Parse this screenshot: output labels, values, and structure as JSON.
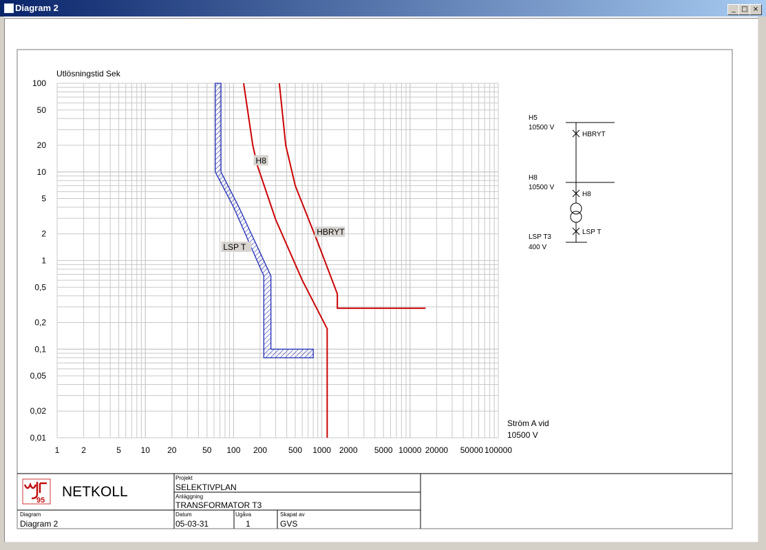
{
  "window": {
    "title": "Diagram 2",
    "min_glyph": "_",
    "max_glyph": "□",
    "close_glyph": "×"
  },
  "chart_data": {
    "type": "line",
    "xscale": "log",
    "yscale": "log",
    "xlim": [
      1,
      100000
    ],
    "ylim": [
      0.01,
      100
    ],
    "ylabel": "Utlösningstid Sek",
    "xlabel_lines": [
      "Ström A vid",
      "10500 V"
    ],
    "xticks": [
      {
        "v": 1,
        "t": "1"
      },
      {
        "v": 2,
        "t": "2"
      },
      {
        "v": 5,
        "t": "5"
      },
      {
        "v": 10,
        "t": "10"
      },
      {
        "v": 20,
        "t": "20"
      },
      {
        "v": 50,
        "t": "50"
      },
      {
        "v": 100,
        "t": "100"
      },
      {
        "v": 200,
        "t": "200"
      },
      {
        "v": 500,
        "t": "500"
      },
      {
        "v": 1000,
        "t": "1000"
      },
      {
        "v": 2000,
        "t": "2000"
      },
      {
        "v": 5000,
        "t": "5000"
      },
      {
        "v": 10000,
        "t": "10000"
      },
      {
        "v": 20000,
        "t": "20000"
      },
      {
        "v": 50000,
        "t": "50000"
      },
      {
        "v": 100000,
        "t": "100000"
      }
    ],
    "yticks": [
      {
        "v": 100,
        "t": "100"
      },
      {
        "v": 50,
        "t": "50"
      },
      {
        "v": 20,
        "t": "20"
      },
      {
        "v": 10,
        "t": "10"
      },
      {
        "v": 5,
        "t": "5"
      },
      {
        "v": 2,
        "t": "2"
      },
      {
        "v": 1,
        "t": "1"
      },
      {
        "v": 0.5,
        "t": "0,5"
      },
      {
        "v": 0.2,
        "t": "0,2"
      },
      {
        "v": 0.1,
        "t": "0,1"
      },
      {
        "v": 0.05,
        "t": "0,05"
      },
      {
        "v": 0.02,
        "t": "0,02"
      },
      {
        "v": 0.01,
        "t": "0,01"
      }
    ],
    "grid": true,
    "series": [
      {
        "name": "HBRYT",
        "color": "#cc0000",
        "points": [
          [
            330,
            100
          ],
          [
            390,
            20
          ],
          [
            500,
            7
          ],
          [
            900,
            1.6
          ],
          [
            1500,
            0.42
          ],
          [
            1500,
            0.29
          ],
          [
            15000,
            0.29
          ]
        ],
        "label_at": [
          860,
          1.95
        ]
      },
      {
        "name": "H8",
        "color": "#cc0000",
        "points": [
          [
            130,
            100
          ],
          [
            165,
            20
          ],
          [
            185,
            12
          ],
          [
            300,
            2.9
          ],
          [
            600,
            0.6
          ],
          [
            1150,
            0.17
          ],
          [
            1150,
            0.01
          ]
        ],
        "label_at": [
          175,
          12.5
        ]
      },
      {
        "name": "LSP T",
        "color": "#1f2bb4",
        "type": "band",
        "lower": [
          [
            62,
            100
          ],
          [
            62,
            10
          ],
          [
            100,
            4
          ],
          [
            220,
            0.67
          ],
          [
            220,
            0.08
          ],
          [
            800,
            0.08
          ]
        ],
        "upper": [
          [
            72,
            100
          ],
          [
            72,
            10
          ],
          [
            115,
            4
          ],
          [
            265,
            0.67
          ],
          [
            265,
            0.1
          ],
          [
            800,
            0.1
          ]
        ],
        "label_at": [
          75,
          1.32
        ]
      }
    ]
  },
  "single_line_diagram": {
    "buses": [
      {
        "name": "H5",
        "voltage": "10500 V"
      },
      {
        "name": "H8",
        "voltage": "10500 V"
      },
      {
        "name": "LSP T3",
        "voltage": "400 V"
      }
    ],
    "breakers": [
      "HBRYT",
      "H8",
      "LSP T"
    ]
  },
  "title_block": {
    "company": "NETKOLL",
    "logo_text": "95",
    "projekt_label": "Projekt",
    "projekt": "SELEKTIVPLAN",
    "anlaggning_label": "Anläggning",
    "anlaggning": "TRANSFORMATOR T3",
    "diagram_label": "Diagram",
    "diagram": "Diagram 2",
    "datum_label": "Datum",
    "datum": "05-03-31",
    "ugava_label": "Ugåva",
    "ugava": "1",
    "skapat_label": "Skapat av",
    "skapat": "GVS"
  }
}
